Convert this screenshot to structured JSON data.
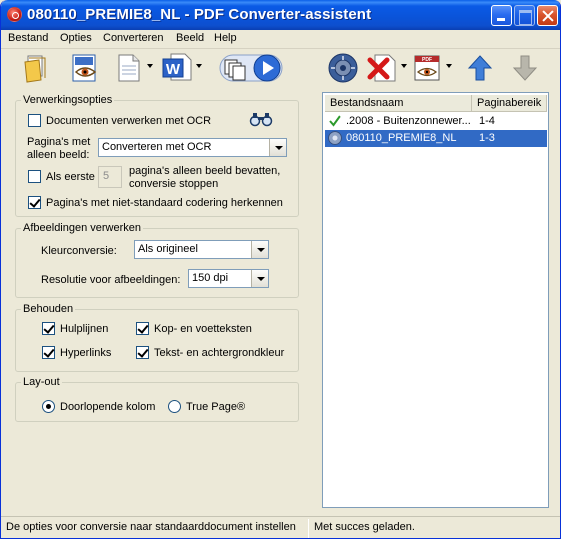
{
  "window": {
    "title": "080110_PREMIE8_NL - PDF Converter-assistent"
  },
  "menu": [
    "Bestand",
    "Opties",
    "Converteren",
    "Beeld",
    "Help"
  ],
  "toolbar": {
    "icons": [
      "open-icon",
      "ocr-eye-icon",
      "document-view-icon",
      "word-format-icon",
      "pages-play-icon",
      "settings-gear-icon",
      "remove-icon",
      "pdf-view-icon",
      "move-up-icon",
      "move-down-icon"
    ]
  },
  "processing": {
    "legend": "Verwerkingsopties",
    "ocr_label": "Documenten verwerken met OCR",
    "ocr_checked": false,
    "image_only_label_1": "Pagina's met",
    "image_only_label_2": "alleen beeld:",
    "image_only_value": "Converteren met OCR",
    "first_label": "Als eerste",
    "first_value": "5",
    "first_suffix_1": "pagina's alleen beeld bevatten,",
    "first_suffix_2": "conversie stoppen",
    "first_checked": false,
    "nonstandard_label": "Pagina's met niet-standaard codering herkennen",
    "nonstandard_checked": true
  },
  "images": {
    "legend": "Afbeeldingen verwerken",
    "color_label": "Kleurconversie:",
    "color_value": "Als origineel",
    "resolution_label": "Resolutie voor afbeeldingen:",
    "resolution_value": "150 dpi"
  },
  "keep": {
    "legend": "Behouden",
    "items": [
      {
        "label": "Hulplijnen",
        "checked": true
      },
      {
        "label": "Kop- en voetteksten",
        "checked": true
      },
      {
        "label": "Hyperlinks",
        "checked": true
      },
      {
        "label": "Tekst- en achtergrondkleur",
        "checked": true
      }
    ]
  },
  "layout": {
    "legend": "Lay-out",
    "options": [
      {
        "label": "Doorlopende kolom",
        "selected": true
      },
      {
        "label": "True Page®",
        "selected": false
      }
    ]
  },
  "files": {
    "columns": [
      "Bestandsnaam",
      "Paginabereik"
    ],
    "rows": [
      {
        "name": ".2008 - Buitenzonnewer...",
        "range": "1-4",
        "status": "done",
        "selected": false
      },
      {
        "name": "080110_PREMIE8_NL",
        "range": "1-3",
        "status": "pending",
        "selected": true
      }
    ]
  },
  "status": {
    "left": "De opties voor conversie naar standaarddocument instellen",
    "right": "Met succes geladen."
  },
  "colors": {
    "titlebar": "#0a53d8",
    "selection": "#316ac5",
    "face": "#ece9d8"
  }
}
